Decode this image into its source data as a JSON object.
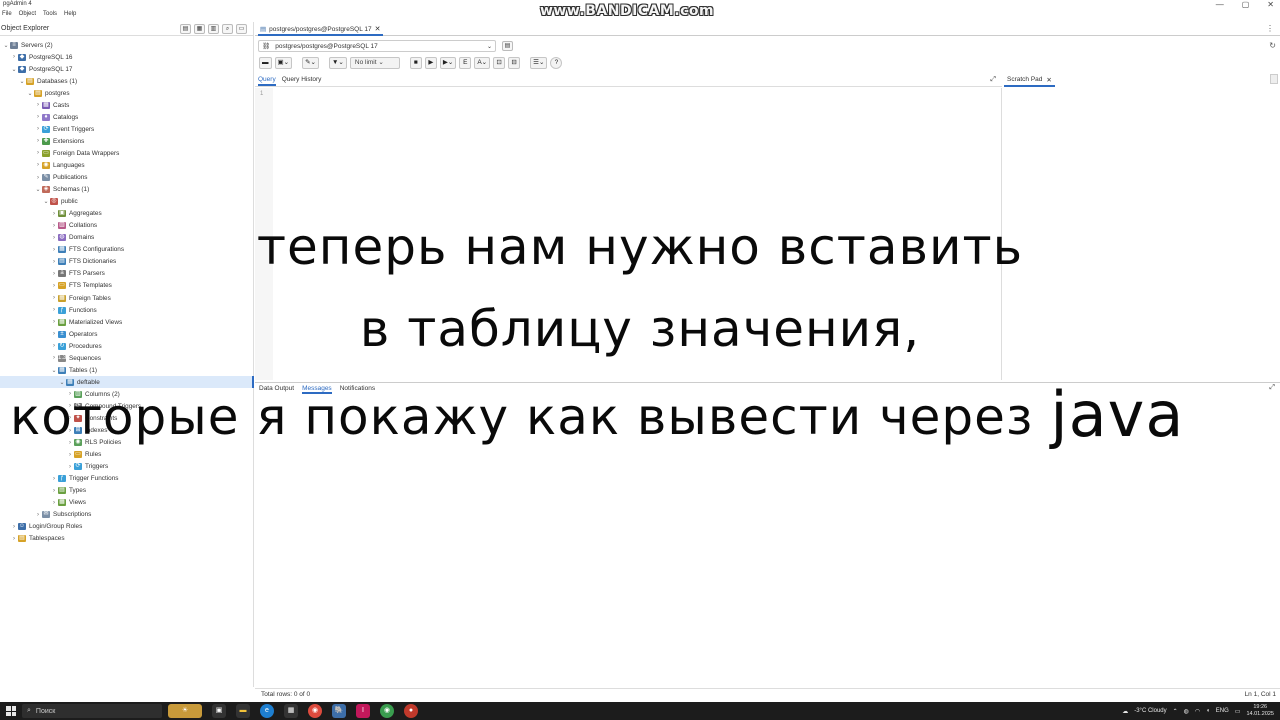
{
  "app": {
    "title": "pgAdmin 4",
    "window_controls": [
      "—",
      "▢",
      "✕"
    ],
    "watermark": "www.BANDICAM.com"
  },
  "menu": [
    "File",
    "Object",
    "Tools",
    "Help"
  ],
  "left_panel": {
    "title": "Object Explorer",
    "tree": [
      {
        "label": "Servers (2)",
        "level": 0,
        "chevron": "expanded",
        "icon": "servers-icon",
        "color": "#6e7f96",
        "glyph": "≡"
      },
      {
        "label": "PostgreSQL 16",
        "level": 1,
        "chevron": "collapsed",
        "icon": "server-icon",
        "color": "#3d6ea8",
        "glyph": "◆"
      },
      {
        "label": "PostgreSQL 17",
        "level": 1,
        "chevron": "expanded",
        "icon": "server-icon",
        "color": "#3d6ea8",
        "glyph": "◆"
      },
      {
        "label": "Databases (1)",
        "level": 2,
        "chevron": "expanded",
        "icon": "databases-icon",
        "color": "#d6a227",
        "glyph": "▤"
      },
      {
        "label": "postgres",
        "level": 3,
        "chevron": "expanded",
        "icon": "database-icon",
        "color": "#d6a227",
        "glyph": "▤"
      },
      {
        "label": "Casts",
        "level": 4,
        "chevron": "collapsed",
        "icon": "casts-icon",
        "color": "#7a5bb5",
        "glyph": "▦"
      },
      {
        "label": "Catalogs",
        "level": 4,
        "chevron": "collapsed",
        "icon": "catalogs-icon",
        "color": "#8f78c9",
        "glyph": "♦"
      },
      {
        "label": "Event Triggers",
        "level": 4,
        "chevron": "collapsed",
        "icon": "event-triggers-icon",
        "color": "#3aa0d8",
        "glyph": "⟳"
      },
      {
        "label": "Extensions",
        "level": 4,
        "chevron": "collapsed",
        "icon": "extensions-icon",
        "color": "#4c9a4c",
        "glyph": "✚"
      },
      {
        "label": "Foreign Data Wrappers",
        "level": 4,
        "chevron": "collapsed",
        "icon": "fdw-icon",
        "color": "#8aa02b",
        "glyph": "▭"
      },
      {
        "label": "Languages",
        "level": 4,
        "chevron": "collapsed",
        "icon": "languages-icon",
        "color": "#d6a227",
        "glyph": "◉"
      },
      {
        "label": "Publications",
        "level": 4,
        "chevron": "collapsed",
        "icon": "publications-icon",
        "color": "#7b8fa6",
        "glyph": "✎"
      },
      {
        "label": "Schemas (1)",
        "level": 4,
        "chevron": "expanded",
        "icon": "schemas-icon",
        "color": "#c06a5a",
        "glyph": "◈"
      },
      {
        "label": "public",
        "level": 5,
        "chevron": "expanded",
        "icon": "schema-icon",
        "color": "#c0524a",
        "glyph": "◎"
      },
      {
        "label": "Aggregates",
        "level": 6,
        "chevron": "collapsed",
        "icon": "aggregates-icon",
        "color": "#6f8f3a",
        "glyph": "▣"
      },
      {
        "label": "Collations",
        "level": 6,
        "chevron": "collapsed",
        "icon": "collations-icon",
        "color": "#b85a8a",
        "glyph": "▥"
      },
      {
        "label": "Domains",
        "level": 6,
        "chevron": "collapsed",
        "icon": "domains-icon",
        "color": "#8a6bc0",
        "glyph": "◍"
      },
      {
        "label": "FTS Configurations",
        "level": 6,
        "chevron": "collapsed",
        "icon": "fts-config-icon",
        "color": "#3d7fb8",
        "glyph": "▦"
      },
      {
        "label": "FTS Dictionaries",
        "level": 6,
        "chevron": "collapsed",
        "icon": "fts-dict-icon",
        "color": "#3d7fb8",
        "glyph": "▤"
      },
      {
        "label": "FTS Parsers",
        "level": 6,
        "chevron": "collapsed",
        "icon": "fts-parsers-icon",
        "color": "#777777",
        "glyph": "a"
      },
      {
        "label": "FTS Templates",
        "level": 6,
        "chevron": "collapsed",
        "icon": "fts-templates-icon",
        "color": "#d6a227",
        "glyph": "▭"
      },
      {
        "label": "Foreign Tables",
        "level": 6,
        "chevron": "collapsed",
        "icon": "foreign-tables-icon",
        "color": "#c8a02b",
        "glyph": "▦"
      },
      {
        "label": "Functions",
        "level": 6,
        "chevron": "collapsed",
        "icon": "functions-icon",
        "color": "#3aa0d8",
        "glyph": "ƒ"
      },
      {
        "label": "Materialized Views",
        "level": 6,
        "chevron": "collapsed",
        "icon": "mat-views-icon",
        "color": "#6aa040",
        "glyph": "▦"
      },
      {
        "label": "Operators",
        "level": 6,
        "chevron": "collapsed",
        "icon": "operators-icon",
        "color": "#3a8fd0",
        "glyph": "±"
      },
      {
        "label": "Procedures",
        "level": 6,
        "chevron": "collapsed",
        "icon": "procedures-icon",
        "color": "#3aa0d8",
        "glyph": "↻"
      },
      {
        "label": "Sequences",
        "level": 6,
        "chevron": "collapsed",
        "icon": "sequences-icon",
        "color": "#888888",
        "glyph": "1.3"
      },
      {
        "label": "Tables (1)",
        "level": 6,
        "chevron": "expanded",
        "icon": "tables-icon",
        "color": "#3d7fb8",
        "glyph": "▦"
      },
      {
        "label": "deftable",
        "level": 7,
        "chevron": "expanded",
        "icon": "table-icon",
        "color": "#3d7fb8",
        "glyph": "▦",
        "selected": true
      },
      {
        "label": "Columns (2)",
        "level": 8,
        "chevron": "collapsed",
        "icon": "columns-icon",
        "color": "#5aa05a",
        "glyph": "▥"
      },
      {
        "label": "Compound Triggers",
        "level": 8,
        "chevron": "collapsed",
        "icon": "compound-triggers-icon",
        "color": "#7a7a7a",
        "glyph": "⟳"
      },
      {
        "label": "Constraints",
        "level": 8,
        "chevron": "collapsed",
        "icon": "constraints-icon",
        "color": "#c0524a",
        "glyph": "✦"
      },
      {
        "label": "Indexes",
        "level": 8,
        "chevron": "collapsed",
        "icon": "indexes-icon",
        "color": "#3d7fb8",
        "glyph": "⊞"
      },
      {
        "label": "RLS Policies",
        "level": 8,
        "chevron": "collapsed",
        "icon": "rls-policies-icon",
        "color": "#5aa05a",
        "glyph": "◉"
      },
      {
        "label": "Rules",
        "level": 8,
        "chevron": "collapsed",
        "icon": "rules-icon",
        "color": "#d6a227",
        "glyph": "▭"
      },
      {
        "label": "Triggers",
        "level": 8,
        "chevron": "collapsed",
        "icon": "triggers-icon",
        "color": "#3aa0d8",
        "glyph": "⟳"
      },
      {
        "label": "Trigger Functions",
        "level": 6,
        "chevron": "collapsed",
        "icon": "trigger-functions-icon",
        "color": "#3aa0d8",
        "glyph": "ƒ"
      },
      {
        "label": "Types",
        "level": 6,
        "chevron": "collapsed",
        "icon": "types-icon",
        "color": "#6aa040",
        "glyph": "▤"
      },
      {
        "label": "Views",
        "level": 6,
        "chevron": "collapsed",
        "icon": "views-icon",
        "color": "#6aa040",
        "glyph": "▦"
      },
      {
        "label": "Subscriptions",
        "level": 4,
        "chevron": "collapsed",
        "icon": "subscriptions-icon",
        "color": "#7b8fa6",
        "glyph": "✉"
      },
      {
        "label": "Login/Group Roles",
        "level": 1,
        "chevron": "collapsed",
        "icon": "roles-icon",
        "color": "#3d6ea8",
        "glyph": "☺"
      },
      {
        "label": "Tablespaces",
        "level": 1,
        "chevron": "collapsed",
        "icon": "tablespaces-icon",
        "color": "#d6a227",
        "glyph": "▤"
      }
    ]
  },
  "main": {
    "tab_title": "postgres/postgres@PostgreSQL 17",
    "connection": "postgres/postgres@PostgreSQL 17",
    "row_limit": "No limit",
    "query_tabs": [
      "Query",
      "Query History"
    ],
    "scratch_pad": "Scratch Pad",
    "line_number": "1",
    "output_tabs": [
      "Data Output",
      "Messages",
      "Notifications"
    ],
    "status_left": "Total rows: 0 of 0",
    "status_right": "Ln 1, Col 1"
  },
  "caption": {
    "line1": "теперь нам нужно вставить",
    "line2": "в таблицу значения,",
    "line3": "которые я покажу как вывести через",
    "line3_word": "java"
  },
  "taskbar": {
    "search_placeholder": "Поиск",
    "weather": "-3°C  Cloudy",
    "lang": "ENG",
    "time": "19:26",
    "date": "14.01.2025"
  }
}
